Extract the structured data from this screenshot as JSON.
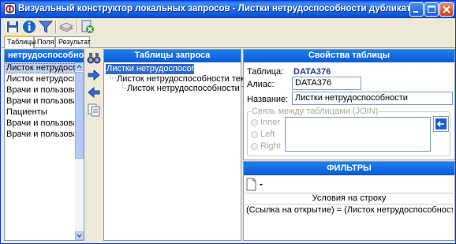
{
  "window": {
    "title": "Визуальный конструктор локальных запросов - Листки нетрудоспособности дубликата"
  },
  "toolbar": {
    "buttons": [
      {
        "icon": "save-icon"
      },
      {
        "icon": "info-icon"
      },
      {
        "icon": "filter-icon"
      },
      {
        "icon": "layers-icon"
      },
      {
        "icon": "exit-icon"
      }
    ]
  },
  "tabs": [
    {
      "label": "Таблицы",
      "active": true
    },
    {
      "label": "Поля",
      "active": false
    },
    {
      "label": "Результат",
      "active": false
    }
  ],
  "left_panel": {
    "header": "нетрудоспособности",
    "items": [
      "Листок нетрудоспособ",
      "Листок нетрудоспособ",
      "Врачи и пользовател",
      "Врачи и пользовател",
      "Пациенты",
      "Врачи и пользовател",
      "Врачи и пользовател"
    ],
    "selected_index": 0
  },
  "middle_buttons": [
    {
      "icon": "binoculars-icon"
    },
    {
      "icon": "arrow-right-icon"
    },
    {
      "icon": "arrow-left-icon"
    },
    {
      "icon": "copy-table-icon"
    }
  ],
  "query_tables": {
    "header": "Таблицы запроса",
    "tree": [
      {
        "label": "Листки нетрудоспособности",
        "level": 0,
        "selected": true
      },
      {
        "label": "Листок нетрудоспособности текущий",
        "level": 1,
        "selected": false
      },
      {
        "label": "Листок нетрудоспособности текущий",
        "level": 2,
        "selected": false
      }
    ]
  },
  "properties": {
    "header": "Свойства таблицы",
    "table_label": "Таблица:",
    "table_value": "DATA376",
    "alias_label": "Алиас:",
    "alias_value": "DATA376",
    "name_label": "Название:",
    "name_value": "Листки нетрудоспособности",
    "join_group": "Связь между таблицами (JOIN)",
    "join_options": [
      "Inner",
      "Left",
      "Right"
    ]
  },
  "filters": {
    "header": "ФИЛЬТРЫ",
    "conditions_header": "Условия на строку",
    "condition_text": "(Ссылка на открытие) = (Листок нетрудоспособности текущий.Ссыл"
  },
  "colors": {
    "header_blue": "#0c5ad6",
    "selection": "#316ac5",
    "accent_tab": "#f7c34a"
  }
}
